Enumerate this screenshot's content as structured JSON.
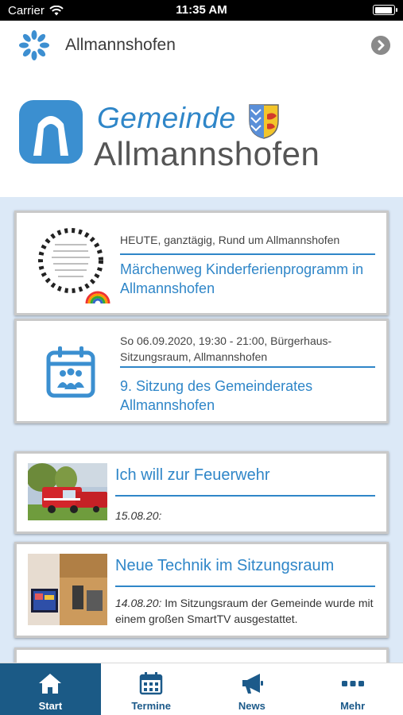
{
  "status_bar": {
    "carrier": "Carrier",
    "time": "11:35 AM",
    "battery_level": 0.95
  },
  "app_bar": {
    "title": "Allmannshofen"
  },
  "banner": {
    "name_line1": "Gemeinde",
    "name_line2": "Allmannshofen"
  },
  "events": [
    {
      "meta": "HEUTE, ganztägig, Rund um Allmannshofen",
      "title": "Märchenweg Kinderferienprogramm in Allmannshofen",
      "thumb_icon": "fairytale-drawing-image"
    },
    {
      "meta": "So 06.09.2020, 19:30 - 21:00, Bürgerhaus-Sitzungsraum, Allmannshofen",
      "title": "9. Sitzung des Gemeinderates Allmannshofen",
      "thumb_icon": "calendar-meeting-icon"
    }
  ],
  "news": [
    {
      "title": "Ich will zur Feuerwehr",
      "date": "15.08.20:",
      "text": ""
    },
    {
      "title": "Neue Technik im Sitzungsraum",
      "date": "14.08.20:",
      "text": " Im Sitzungsraum der Gemeinde wurde mit einem großen SmartTV ausgestattet."
    }
  ],
  "tabs": [
    {
      "label": "Start",
      "icon": "home-icon",
      "active": true
    },
    {
      "label": "Termine",
      "icon": "calendar-icon",
      "active": false
    },
    {
      "label": "News",
      "icon": "megaphone-icon",
      "active": false
    },
    {
      "label": "Mehr",
      "icon": "more-dots-icon",
      "active": false
    }
  ],
  "colors": {
    "accent": "#2f86c8",
    "tab_active": "#1b5a86",
    "content_bg": "#dce9f7"
  }
}
